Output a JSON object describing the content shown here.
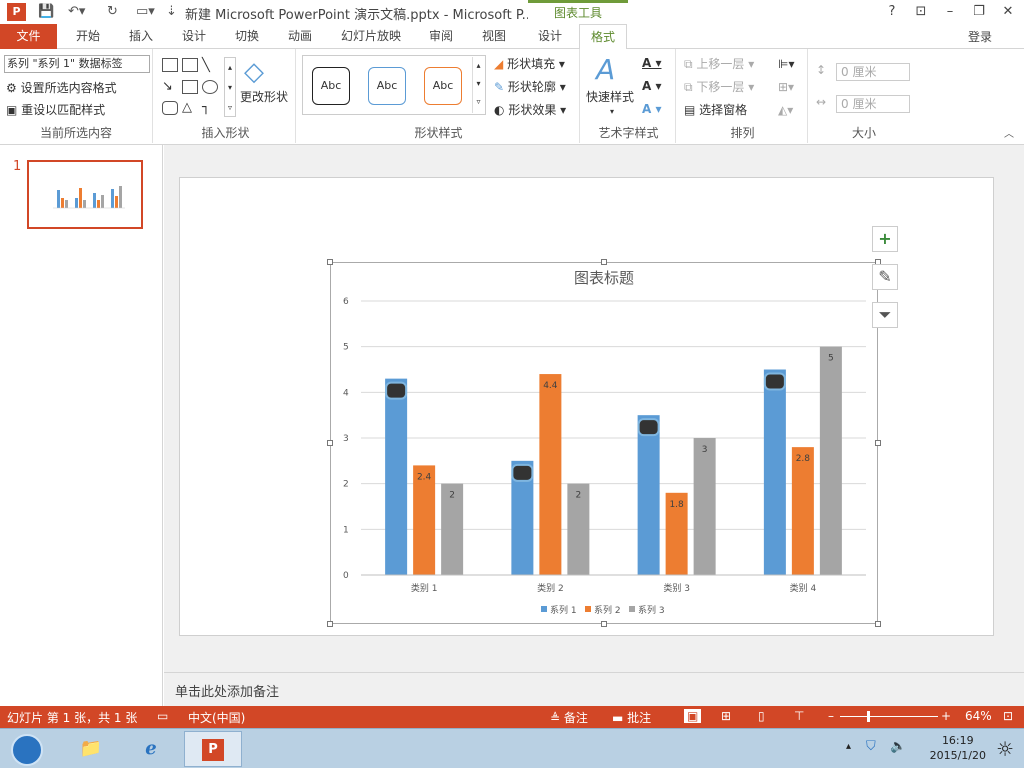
{
  "window": {
    "logo": "P",
    "title": "新建 Microsoft PowerPoint 演示文稿.pptx - Microsoft P...",
    "context_label": "图表工具",
    "help": "?",
    "minimize": "–",
    "maximize": "❐",
    "close": "✕"
  },
  "tabs": {
    "file": "文件",
    "home": "开始",
    "insert": "插入",
    "design": "设计",
    "transitions": "切换",
    "animations": "动画",
    "slideshow": "幻灯片放映",
    "review": "审阅",
    "view": "视图",
    "chart_design": "设计",
    "chart_format": "格式",
    "signin": "登录"
  },
  "ribbon": {
    "current_selection": {
      "dropdown": "系列 \"系列 1\" 数据标签",
      "format_selection": "设置所选内容格式",
      "reset_style": "重设以匹配样式",
      "label": "当前所选内容"
    },
    "insert_shapes": {
      "change_shape": "更改形状",
      "label": "插入形状"
    },
    "shape_styles": {
      "sample": "Abc",
      "fill": "形状填充",
      "outline": "形状轮廓",
      "effects": "形状效果",
      "label": "形状样式"
    },
    "wordart": {
      "quick_styles": "快速样式",
      "label": "艺术字样式"
    },
    "arrange": {
      "bring_forward": "上移一层",
      "send_backward": "下移一层",
      "selection_pane": "选择窗格",
      "label": "排列"
    },
    "size": {
      "height": "0 厘米",
      "width": "0 厘米",
      "label": "大小"
    }
  },
  "slides_panel": {
    "slide_number": "1"
  },
  "notes": {
    "placeholder": "单击此处添加备注"
  },
  "status": {
    "slide_info": "幻灯片 第 1 张，共 1 张",
    "language": "中文(中国)",
    "notes_btn": "备注",
    "comments_btn": "批注",
    "zoom": "64%"
  },
  "taskbar": {
    "time": "16:19",
    "date": "2015/1/20"
  },
  "colors": {
    "accent": "#d24726",
    "series1": "#5b9bd5",
    "series2": "#ed7d31",
    "series3": "#a5a5a5",
    "context_green": "#5d8a2d"
  },
  "icons": {
    "add_element": "+",
    "filter": "funnel-icon",
    "style": "brush-icon"
  },
  "chart_data": {
    "type": "bar",
    "title": "图表标题",
    "categories": [
      "类别 1",
      "类别 2",
      "类别 3",
      "类别 4"
    ],
    "series": [
      {
        "name": "系列 1",
        "values": [
          4.3,
          2.5,
          3.5,
          4.5
        ]
      },
      {
        "name": "系列 2",
        "values": [
          2.4,
          4.4,
          1.8,
          2.8
        ]
      },
      {
        "name": "系列 3",
        "values": [
          2,
          2,
          3,
          5
        ]
      }
    ],
    "data_labels": [
      {
        "series": 1,
        "labels": [
          "2.4",
          "4.4",
          "1.8",
          "2.8"
        ]
      },
      {
        "series": 2,
        "labels": [
          "2",
          "2",
          "3",
          "5"
        ]
      }
    ],
    "ylim": [
      0,
      6
    ],
    "yticks": [
      "0",
      "1",
      "2",
      "3",
      "4",
      "5",
      "6"
    ],
    "grid": true,
    "legend": "bottom"
  }
}
